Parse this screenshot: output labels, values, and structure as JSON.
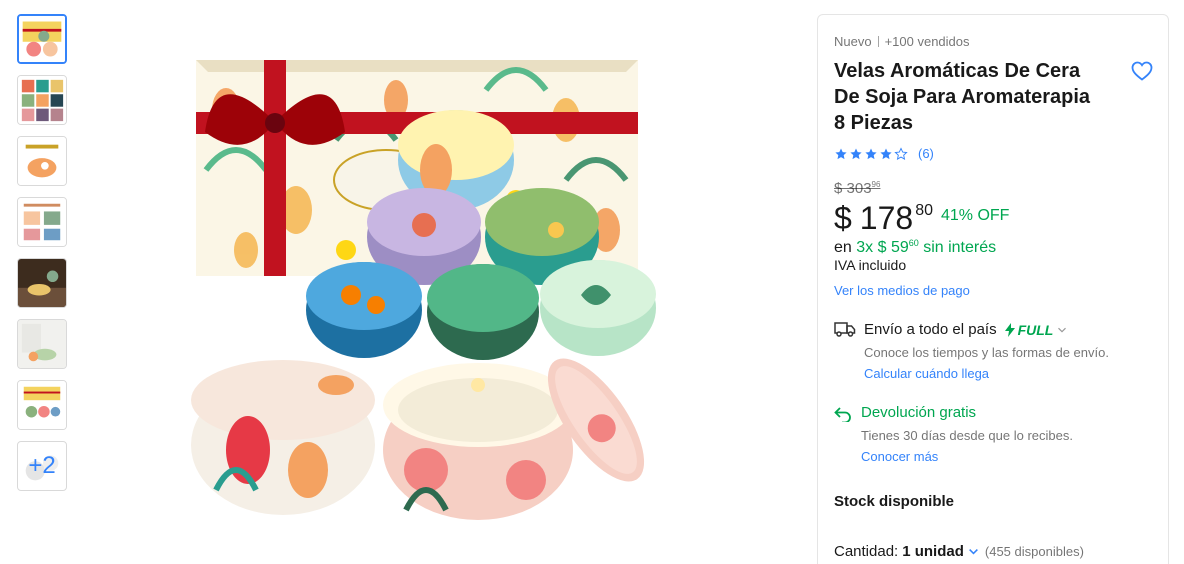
{
  "gallery": {
    "more_label": "+2"
  },
  "product": {
    "condition": "Nuevo",
    "sold": "+100 vendidos",
    "title": "Velas Aromáticas De Cera De Soja Para Aromaterapia 8 Piezas",
    "rating_stars": 4,
    "rating_count": "(6)",
    "old_price_main": "$ 303",
    "old_price_cents": "96",
    "currency": "$",
    "price_main": "178",
    "price_cents": "80",
    "discount": "41% OFF",
    "installments_prefix": "en",
    "installments_main": "3x $ 59",
    "installments_cents": "60",
    "installments_suffix": "sin interés",
    "iva": "IVA incluido",
    "payment_link": "Ver los medios de pago"
  },
  "shipping": {
    "title": "Envío a todo el país",
    "full_label": "FULL",
    "description": "Conoce los tiempos y las formas de envío.",
    "link": "Calcular cuándo llega"
  },
  "returns": {
    "title": "Devolución gratis",
    "description": "Tienes 30 días desde que lo recibes.",
    "link": "Conocer más"
  },
  "stock": {
    "title": "Stock disponible",
    "quantity_label": "Cantidad:",
    "quantity_value": "1 unidad",
    "available": "(455 disponibles)"
  },
  "colors": {
    "accent": "#3483fa",
    "green": "#00a650"
  }
}
